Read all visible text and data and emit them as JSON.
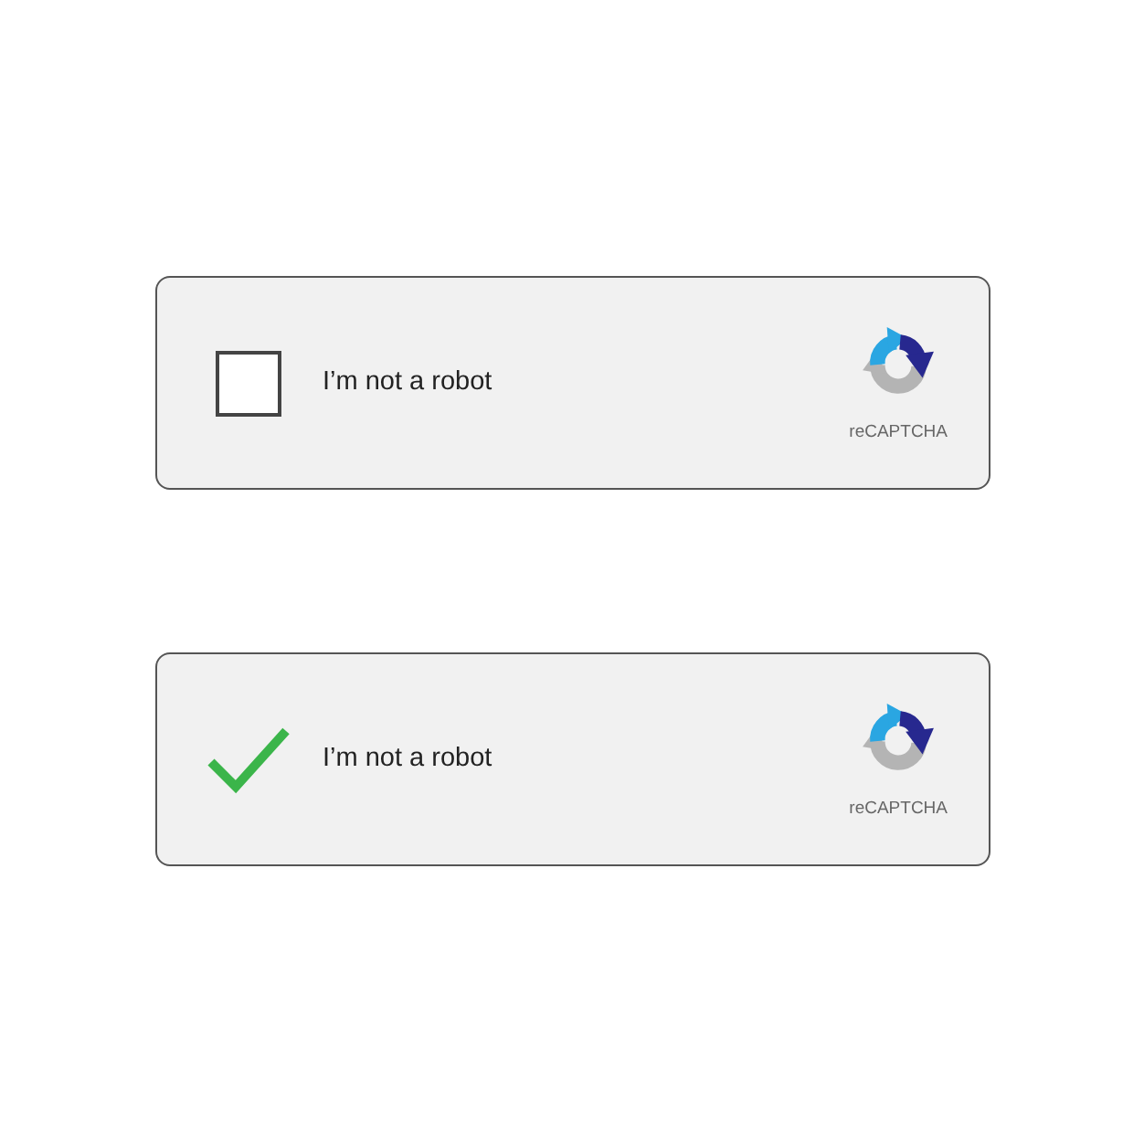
{
  "widgets": [
    {
      "checked": false,
      "label": "I’m not a robot",
      "brand": "reCAPTCHA"
    },
    {
      "checked": true,
      "label": "I’m not a robot",
      "brand": "reCAPTCHA"
    }
  ]
}
